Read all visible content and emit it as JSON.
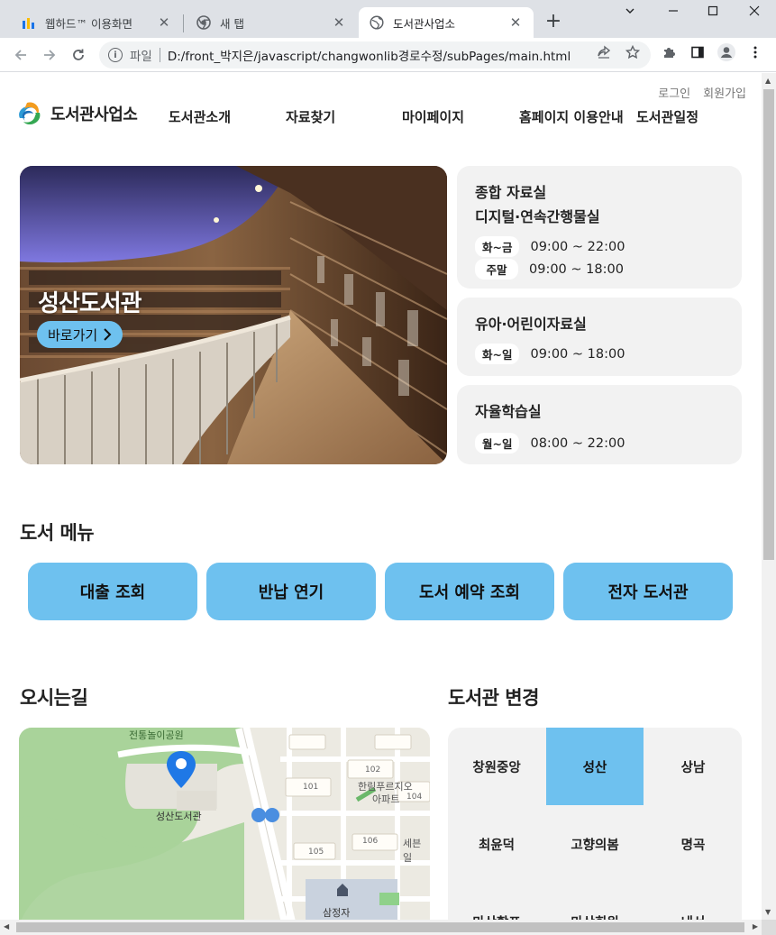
{
  "browser": {
    "tabs": [
      {
        "title": "웹하드™ 이용화면",
        "close": "✕"
      },
      {
        "title": "새 탭",
        "close": "✕"
      },
      {
        "title": "도서관사업소",
        "close": "✕"
      }
    ],
    "new_tab": "+",
    "address": {
      "scheme": "파일",
      "url": "D:/front_박지은/javascript/changwonlib경로수정/subPages/main.html"
    }
  },
  "header": {
    "links": [
      "로그인",
      "회원가입"
    ],
    "logo_text": "도서관사업소",
    "nav": [
      "도서관소개",
      "자료찾기",
      "마이페이지",
      "홈페이지 이용안내",
      "도서관일정"
    ]
  },
  "hero": {
    "title": "성산도서관",
    "button": "바로가기"
  },
  "rooms": [
    {
      "name": "종합 자료실",
      "name2": "디지털·연속간행물실",
      "hours": [
        {
          "day": "화~금",
          "time": "09:00 ~ 22:00"
        },
        {
          "day": "주말",
          "time": "09:00 ~ 18:00"
        }
      ]
    },
    {
      "name": "유아·어린이자료실",
      "hours": [
        {
          "day": "화~일",
          "time": "09:00 ~ 18:00"
        }
      ]
    },
    {
      "name": "자율학습실",
      "hours": [
        {
          "day": "월~일",
          "time": "08:00 ~ 22:00"
        }
      ]
    }
  ],
  "book_menu": {
    "title": "도서 메뉴",
    "items": [
      "대출 조회",
      "반납 연기",
      "도서 예약 조회",
      "전자 도서관"
    ]
  },
  "directions": {
    "title": "오시는길",
    "map_labels": {
      "park": "전통놀이공원",
      "library": "성산도서관",
      "apt": "한림푸르지오",
      "apt2": "아파트",
      "b101": "101",
      "b102": "102",
      "b104": "104",
      "b105": "105",
      "b106": "106",
      "se": "세븐일",
      "sam": "삼정자"
    }
  },
  "branches": {
    "title": "도서관 변경",
    "items": [
      "창원중앙",
      "성산",
      "상남",
      "최윤덕",
      "고향의봄",
      "명곡",
      "마산합포",
      "마산회원",
      "내서"
    ],
    "active": "성산"
  },
  "colors": {
    "accent": "#6ec1ef",
    "card_bg": "#f2f2f2"
  }
}
